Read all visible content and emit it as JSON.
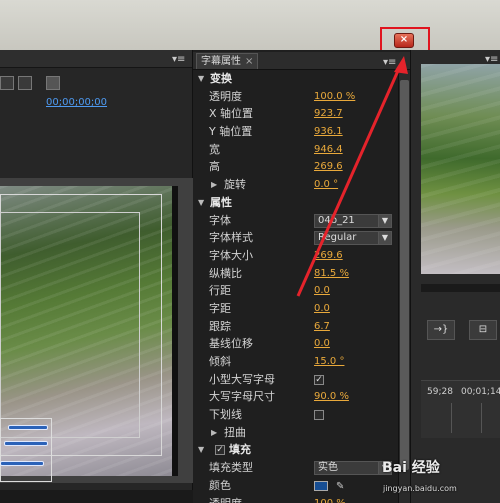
{
  "window": {
    "close_glyph": "×"
  },
  "left_panel": {
    "timecode": "00;00;00;00"
  },
  "middle_panel": {
    "tab_label": "字幕属性",
    "tab_close": "×",
    "rows": [
      {
        "label": "变换",
        "section": true
      },
      {
        "label": "透明度",
        "value": "100.0 %"
      },
      {
        "label": "X 轴位置",
        "value": "923.7"
      },
      {
        "label": "Y 轴位置",
        "value": "936.1"
      },
      {
        "label": "宽",
        "value": "946.4"
      },
      {
        "label": "高",
        "value": "269.6"
      },
      {
        "label": "旋转",
        "value": "0.0 °",
        "sub": true
      },
      {
        "label": "属性",
        "section": true
      },
      {
        "label": "字体",
        "dropdown": "04b_21"
      },
      {
        "label": "字体样式",
        "dropdown": "Regular"
      },
      {
        "label": "字体大小",
        "value": "269.6"
      },
      {
        "label": "纵横比",
        "value": "81.5 %"
      },
      {
        "label": "行距",
        "value": "0.0"
      },
      {
        "label": "字距",
        "value": "0.0"
      },
      {
        "label": "跟踪",
        "value": "6.7"
      },
      {
        "label": "基线位移",
        "value": "0.0"
      },
      {
        "label": "倾斜",
        "value": "15.0 °"
      },
      {
        "label": "小型大写字母",
        "checkbox": true
      },
      {
        "label": "大写字母尺寸",
        "value": "90.0 %"
      },
      {
        "label": "下划线",
        "checkbox": false
      },
      {
        "label": "扭曲",
        "sub": true
      },
      {
        "label": "填充",
        "section": true,
        "checkbox_left": true
      },
      {
        "label": "填充类型",
        "dropdown": "实色"
      },
      {
        "label": "颜色",
        "swatch": "#174e93"
      },
      {
        "label": "透明度",
        "value": "100 %"
      }
    ]
  },
  "right_panel": {
    "buttons": [
      "→}",
      "⊟"
    ],
    "timecodes": [
      "59;28",
      "00;01;14;2"
    ]
  },
  "watermark": {
    "brand": "Bai 经验",
    "url": "jingyan.baidu.com"
  },
  "colors": {
    "value_orange": "#e9a93b",
    "highlight_red": "#e0141e",
    "timecode_blue": "#4e9af1"
  }
}
